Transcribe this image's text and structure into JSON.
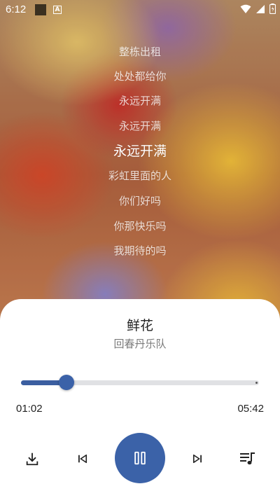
{
  "status_bar": {
    "time": "6:12",
    "notification_badge": "A"
  },
  "lyrics": [
    "整栋出租",
    "处处都给你",
    "永远开满",
    "永远开满",
    "永远开满",
    "彩虹里面的人",
    "你们好吗",
    "你那快乐吗",
    "我期待的吗"
  ],
  "current_lyric_index": 4,
  "player": {
    "title": "鲜花",
    "artist": "回春丹乐队",
    "current_time": "01:02",
    "total_time": "05:42",
    "progress_fraction": 0.19,
    "accent_color": "#3b62a8",
    "buttons": {
      "download": "download-icon",
      "previous": "skip-previous-icon",
      "play_pause": "pause-icon",
      "next": "skip-next-icon",
      "playlist": "playlist-music-icon"
    }
  }
}
